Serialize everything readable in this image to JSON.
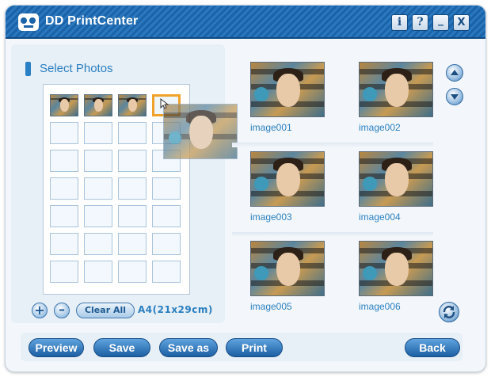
{
  "window": {
    "title": "DD PrintCenter",
    "controls": {
      "info_label": "i",
      "help_label": "?",
      "minimize_label": "_",
      "close_label": "X"
    }
  },
  "left_panel": {
    "section_title": "Select Photos",
    "layout_grid": {
      "columns": 4,
      "rows": 7,
      "filled_slots": 3,
      "highlighted_slot": 4
    },
    "controls": {
      "add_label": "+",
      "remove_label": "–",
      "clear_all_label": "Clear All",
      "paper_size": "A4(21x29cm)"
    }
  },
  "gallery": {
    "photos": [
      {
        "label": "image001"
      },
      {
        "label": "image002"
      },
      {
        "label": "image003"
      },
      {
        "label": "image004"
      },
      {
        "label": "image005"
      },
      {
        "label": "image006"
      }
    ],
    "scroll_up_icon": "arrow-up-icon",
    "scroll_down_icon": "arrow-down-icon",
    "refresh_icon": "refresh-icon"
  },
  "footer": {
    "preview_label": "Preview",
    "save_label": "Save",
    "save_as_label": "Save as",
    "print_label": "Print",
    "back_label": "Back"
  },
  "colors": {
    "title_bar": "#1a63a8",
    "accent_text": "#2a7fc0",
    "button_blue": "#1c5fa3",
    "highlight_slot": "#f0a12a",
    "panel_bg": "#e7eff7"
  }
}
